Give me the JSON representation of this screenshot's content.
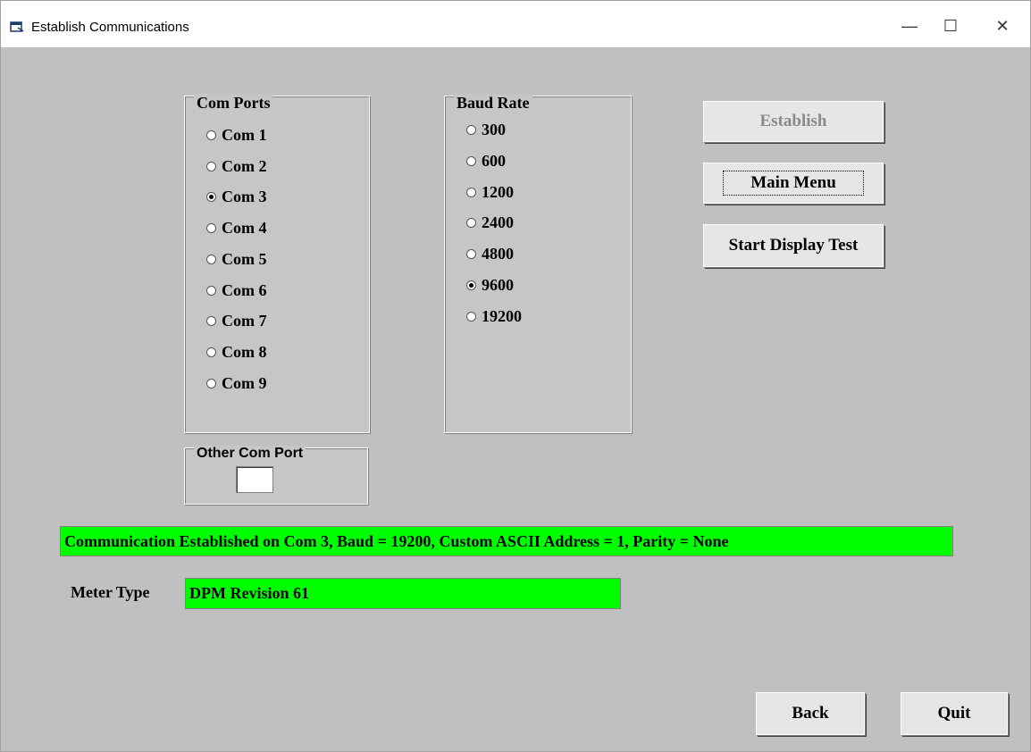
{
  "window": {
    "title": "Establish Communications",
    "controls": {
      "minimize": "—",
      "maximize": "☐",
      "close": "✕"
    }
  },
  "com_ports": {
    "title": "Com Ports",
    "options": [
      "Com 1",
      "Com 2",
      "Com 3",
      "Com 4",
      "Com 5",
      "Com 6",
      "Com 7",
      "Com 8",
      "Com 9"
    ],
    "selected": "Com 3"
  },
  "baud_rate": {
    "title": "Baud Rate",
    "options": [
      "300",
      "600",
      "1200",
      "2400",
      "4800",
      "9600",
      "19200"
    ],
    "selected": "9600"
  },
  "other_com_port": {
    "title": "Other Com Port",
    "value": ""
  },
  "buttons": {
    "establish": "Establish",
    "main_menu": "Main Menu",
    "start_display_test": "Start Display Test",
    "back": "Back",
    "quit": "Quit"
  },
  "status": {
    "message": "Communication Established on Com  3, Baud = 19200, Custom ASCII Address = 1, Parity = None"
  },
  "meter": {
    "label": "Meter Type",
    "value": "DPM Revision 61"
  },
  "colors": {
    "status_bg": "#00ff00",
    "window_bg": "#c0c0c0"
  }
}
